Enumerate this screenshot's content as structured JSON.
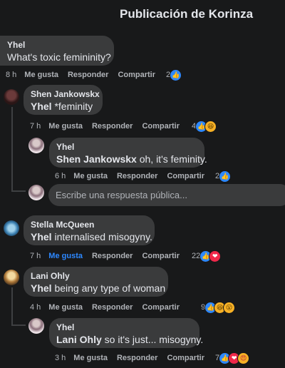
{
  "header": {
    "title": "Publicación de Korinza"
  },
  "actions": {
    "like": "Me gusta",
    "reply": "Responder",
    "share": "Compartir"
  },
  "reply_box": {
    "placeholder": "Escribe una respuesta pública..."
  },
  "comments": [
    {
      "author": "Yhel",
      "text": "What's toxic femininity?",
      "time": "8 h",
      "reaction_count": "2",
      "reactions": [
        "like"
      ]
    },
    {
      "author": "Shen Jankowskx",
      "mention": "Yhel",
      "text": " *feminity",
      "time": "7 h",
      "reaction_count": "4",
      "reactions": [
        "like",
        "haha"
      ]
    },
    {
      "author": "Yhel",
      "mention": "Shen Jankowskx",
      "text": " oh, it's feminity.",
      "time": "6 h",
      "reaction_count": "2",
      "reactions": [
        "like"
      ]
    },
    {
      "author": "Stella McQueen",
      "mention": "Yhel",
      "text": " internalised misogyny.",
      "time": "7 h",
      "liked": true,
      "reaction_count": "22",
      "reactions": [
        "like",
        "love"
      ]
    },
    {
      "author": "Lani Ohly",
      "mention": "Yhel",
      "text": " being any type of woman",
      "time": "4 h",
      "reaction_count": "9",
      "reactions": [
        "like",
        "haha",
        "wow"
      ]
    },
    {
      "author": "Yhel",
      "mention": "Lani Ohly",
      "text": " so it's just... misogyny.",
      "time": "3 h",
      "reaction_count": "7",
      "reactions": [
        "like",
        "love",
        "care"
      ]
    }
  ],
  "colors": {
    "background": "#18191a",
    "bubble": "#3a3b3c",
    "accent": "#2d88ff",
    "muted": "#b0b3b8"
  }
}
